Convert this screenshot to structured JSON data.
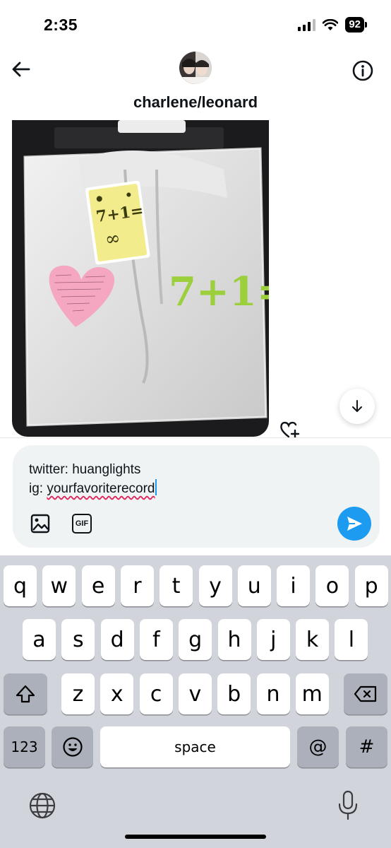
{
  "status_bar": {
    "time": "2:35",
    "battery": "92",
    "icons": [
      "signal-icon",
      "wifi-icon",
      "battery-icon"
    ]
  },
  "header": {
    "title": "charlene/leonard",
    "icons": [
      "back-arrow-icon",
      "avatar",
      "info-icon"
    ]
  },
  "photo": {
    "card_text": "7+1=∞",
    "print_text": "7+1=",
    "note": "pink heart note"
  },
  "composer": {
    "line1": "twitter: huanglights",
    "line2_prefix": "ig: ",
    "line2_word": "yourfavoriterecord",
    "gif_label": "GIF"
  },
  "keyboard": {
    "row1": [
      "q",
      "w",
      "e",
      "r",
      "t",
      "y",
      "u",
      "i",
      "o",
      "p"
    ],
    "row2": [
      "a",
      "s",
      "d",
      "f",
      "g",
      "h",
      "j",
      "k",
      "l"
    ],
    "row3": [
      "z",
      "x",
      "c",
      "v",
      "b",
      "n",
      "m"
    ],
    "numbers_label": "123",
    "space_label": "space",
    "at_label": "@",
    "hash_label": "#"
  },
  "colors": {
    "accent": "#1d9bf0",
    "keyboard_bg": "#d1d4da",
    "composer_bg": "#eff3f4"
  }
}
